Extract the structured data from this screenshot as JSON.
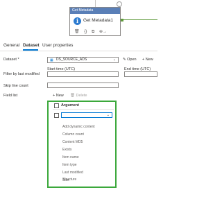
{
  "activity": {
    "header_label": "Get Metadata",
    "name": "Get Metadata1",
    "info_glyph": "i",
    "tool_icons": [
      "trash-icon",
      "code-icon",
      "copy-icon",
      "arrow-forward-icon"
    ]
  },
  "tabs": [
    {
      "label": "General"
    },
    {
      "label": "Dataset",
      "active": true
    },
    {
      "label": "User properties"
    }
  ],
  "form": {
    "dataset_label": "Dataset *",
    "dataset_value": "DS_SOURCE_ADS",
    "open_label": "Open",
    "new_label": "New",
    "filter_label": "Filter by last modified",
    "start_time_label": "Start time (UTC)",
    "end_time_label": "End time (UTC)",
    "skip_line_label": "Skip line count",
    "field_list_label": "Field list",
    "add_new_label": "New",
    "delete_label": "Delete"
  },
  "field_list": {
    "header": "Argument",
    "options": [
      "Add dynamic content",
      "Column count",
      "Content MD5",
      "Exists",
      "Item name",
      "Item type",
      "Last modified",
      "Size",
      "Structure"
    ]
  },
  "colors": {
    "accent": "#0078d4",
    "highlight_border": "#3ba83b",
    "activity_header": "#5a7fb7"
  }
}
